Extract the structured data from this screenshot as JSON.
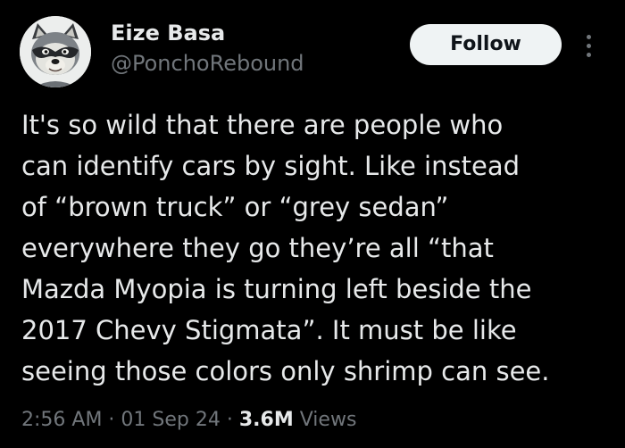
{
  "author": {
    "display_name": "Eize Basa",
    "handle": "@PonchoRebound",
    "avatar_icon": "raccoon-avatar-icon"
  },
  "actions": {
    "follow_label": "Follow",
    "more_icon": "more-options-icon"
  },
  "tweet": {
    "lines": [
      "It's so wild that there are people who",
      "can identify cars by sight. Like instead",
      "of “brown truck” or “grey sedan”",
      "everywhere they go they’re all “that",
      "Mazda Myopia is turning left beside the",
      "2017 Chevy Stigmata”. It must be like",
      "seeing those colors only shrimp can see."
    ]
  },
  "meta": {
    "time": "2:56 AM",
    "separator": " · ",
    "date": "01 Sep 24",
    "views_count": "3.6M",
    "views_label": "Views"
  },
  "colors": {
    "background": "#000000",
    "primary_text": "#e7e9ea",
    "secondary_text": "#71767b",
    "follow_button_bg": "#eff3f4",
    "follow_button_text": "#0f1419"
  }
}
